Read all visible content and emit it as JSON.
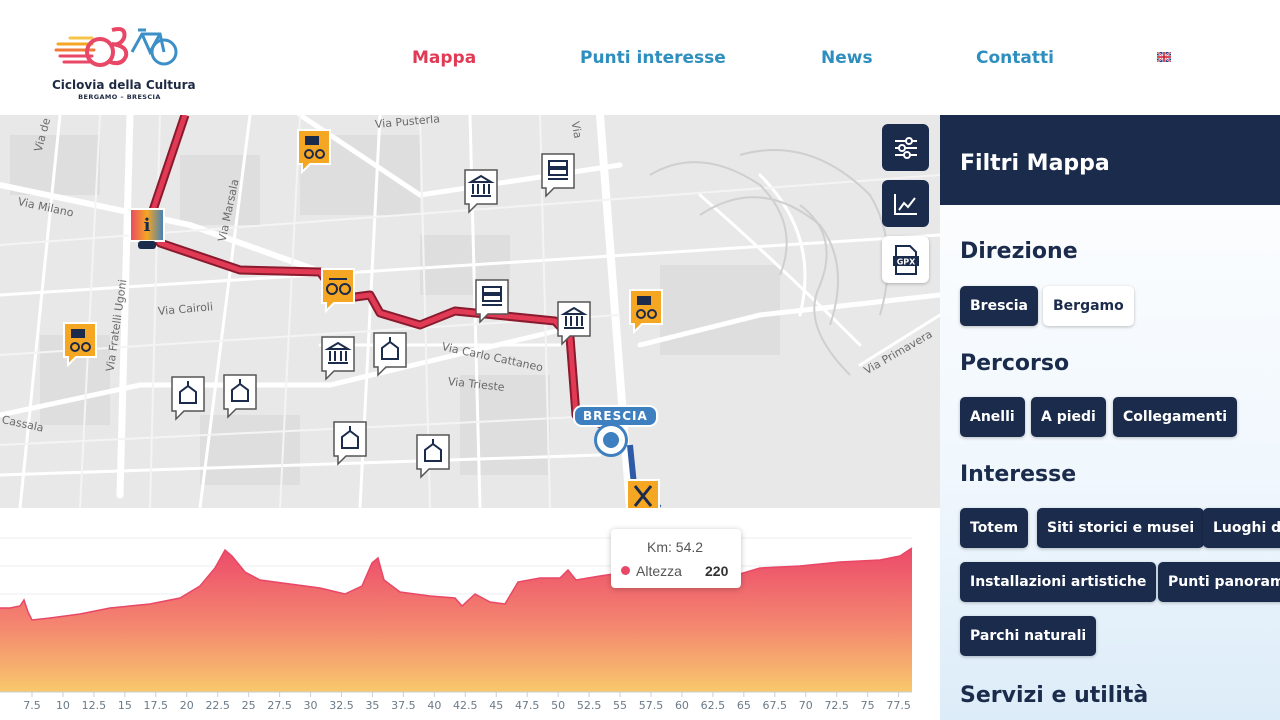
{
  "brand": {
    "name": "Ciclovia della Cultura",
    "subtitle": "BERGAMO – BRESCIA"
  },
  "nav": {
    "items": [
      {
        "label": "Mappa",
        "active": true
      },
      {
        "label": "Punti interesse",
        "active": false
      },
      {
        "label": "News",
        "active": false
      },
      {
        "label": "Contatti",
        "active": false
      }
    ],
    "language_icon": "uk-flag-icon"
  },
  "map": {
    "street_labels": [
      "Via Pusterla",
      "Via Milano",
      "Via Marsala",
      "Via Cairoli",
      "Via Fratelli Ugoni",
      "Via Carlo Cattaneo",
      "Via Trieste",
      "Via Primavera",
      "Cassala",
      "Via de",
      "Via"
    ],
    "city_label": "BRESCIA",
    "controls": {
      "filters_icon": "sliders-icon",
      "profile_icon": "line-chart-icon",
      "gpx_label": "GPX"
    }
  },
  "elevation": {
    "tooltip": {
      "km_label": "Km: 54.2",
      "series_label": "Altezza",
      "value": "220"
    },
    "x_ticks": [
      "7.5",
      "10",
      "12.5",
      "15",
      "17.5",
      "20",
      "22.5",
      "25",
      "27.5",
      "30",
      "32.5",
      "35",
      "37.5",
      "40",
      "42.5",
      "45",
      "47.5",
      "50",
      "52.5",
      "55",
      "57.5",
      "60",
      "62.5",
      "65",
      "67.5",
      "70",
      "72.5",
      "75",
      "77.5"
    ],
    "colors": {
      "top": "#e84766",
      "bottom": "#f7c86a"
    }
  },
  "sidebar": {
    "title": "Filtri Mappa",
    "sections": {
      "direzione": {
        "title": "Direzione",
        "options": [
          "Brescia",
          "Bergamo"
        ],
        "selected": "Brescia"
      },
      "percorso": {
        "title": "Percorso",
        "options": [
          "Anelli",
          "A piedi",
          "Collegamenti"
        ]
      },
      "interesse": {
        "title": "Interesse",
        "options": [
          "Totem",
          "Siti storici e musei",
          "Luoghi di",
          "Installazioni artistiche",
          "Punti panorami",
          "Parchi naturali"
        ]
      },
      "servizi": {
        "title": "Servizi e utilità"
      }
    }
  }
}
